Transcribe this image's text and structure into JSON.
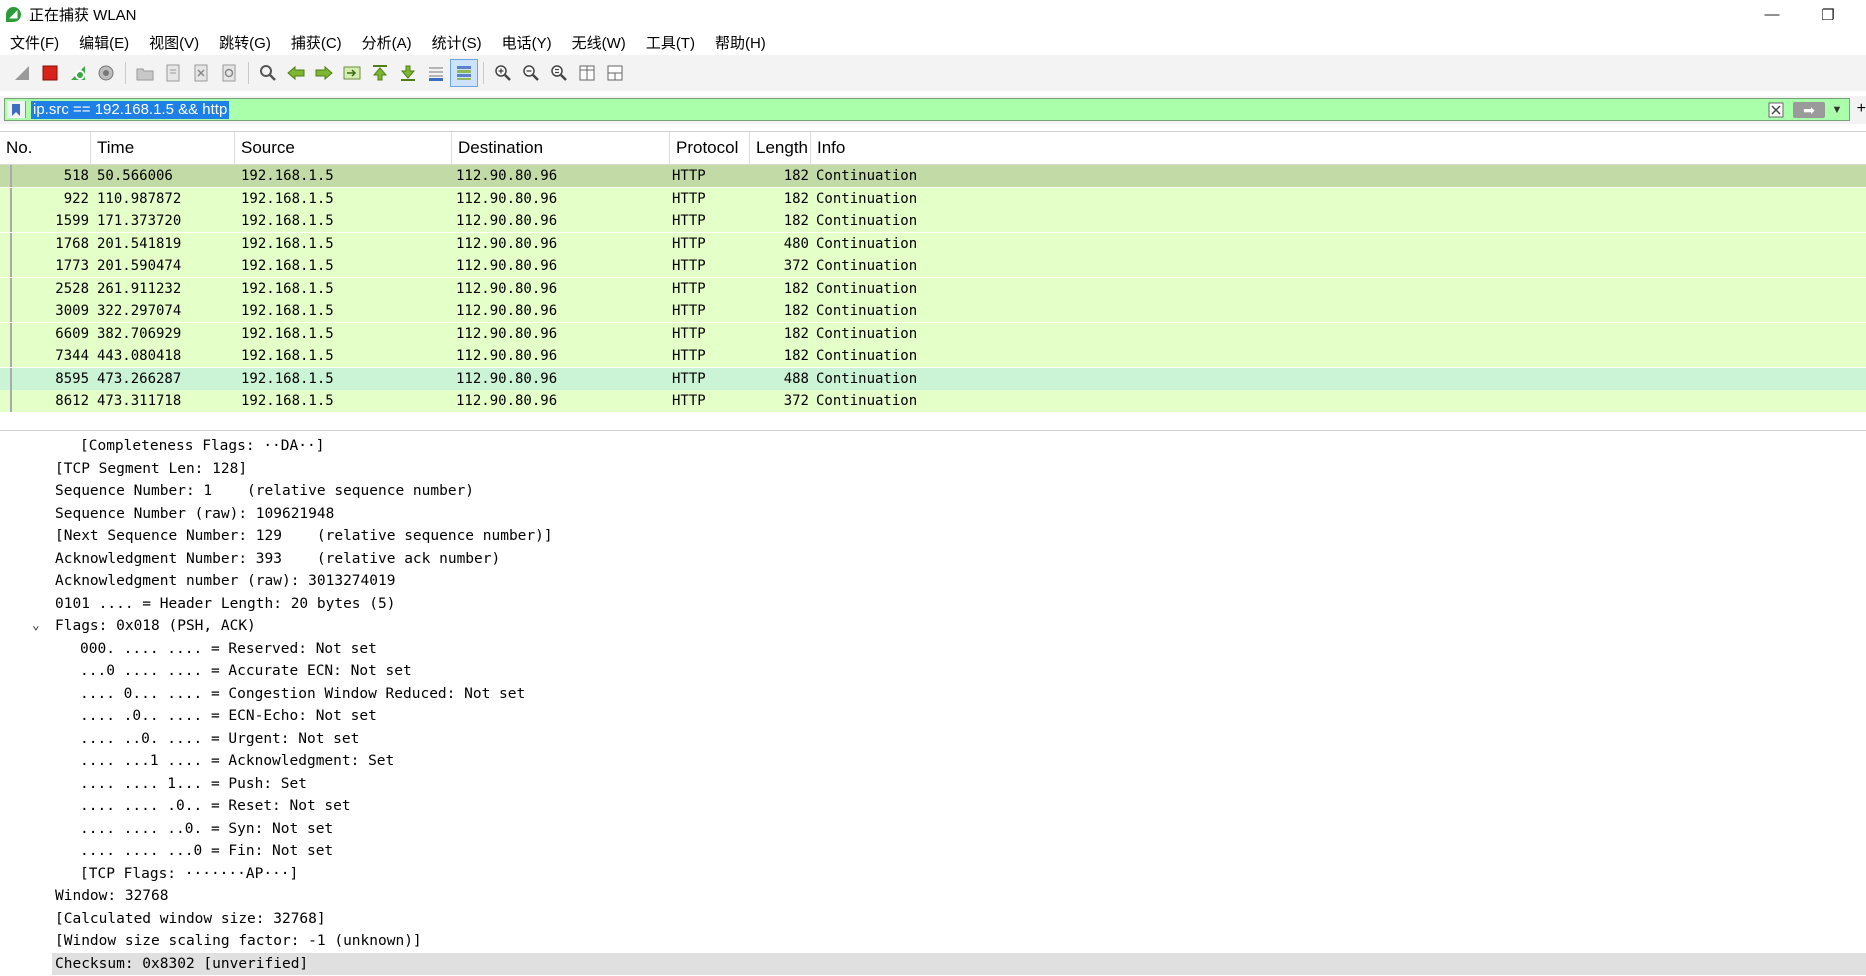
{
  "window": {
    "title": "正在捕获 WLAN",
    "minimize_glyph": "—",
    "restore_glyph": "❐"
  },
  "menu": [
    "文件(F)",
    "编辑(E)",
    "视图(V)",
    "跳转(G)",
    "捕获(C)",
    "分析(A)",
    "统计(S)",
    "电话(Y)",
    "无线(W)",
    "工具(T)",
    "帮助(H)"
  ],
  "toolbar": {
    "icons": [
      "shark-fin-icon",
      "stop-capture-icon",
      "restart-capture-icon",
      "capture-options-icon",
      "open-file-icon",
      "save-file-icon",
      "close-file-icon",
      "reload-file-icon",
      "find-packet-icon",
      "go-back-icon",
      "go-forward-icon",
      "go-to-packet-icon",
      "go-first-icon",
      "go-last-icon",
      "autoscroll-icon",
      "colorize-icon",
      "zoom-in-icon",
      "zoom-out-icon",
      "zoom-normal-icon",
      "resize-columns-icon",
      "layout-icon"
    ]
  },
  "filter": {
    "value": "ip.src == 192.168.1.5 && http",
    "plus": "+"
  },
  "columns": [
    "No.",
    "Time",
    "Source",
    "Destination",
    "Protocol",
    "Length",
    "Info"
  ],
  "packets": [
    {
      "no": "518",
      "time": "50.566006",
      "src": "192.168.1.5",
      "dst": "112.90.80.96",
      "proto": "HTTP",
      "len": "182",
      "info": "Continuation",
      "state": "selected"
    },
    {
      "no": "922",
      "time": "110.987872",
      "src": "192.168.1.5",
      "dst": "112.90.80.96",
      "proto": "HTTP",
      "len": "182",
      "info": "Continuation",
      "state": "normal"
    },
    {
      "no": "1599",
      "time": "171.373720",
      "src": "192.168.1.5",
      "dst": "112.90.80.96",
      "proto": "HTTP",
      "len": "182",
      "info": "Continuation",
      "state": "normal"
    },
    {
      "no": "1768",
      "time": "201.541819",
      "src": "192.168.1.5",
      "dst": "112.90.80.96",
      "proto": "HTTP",
      "len": "480",
      "info": "Continuation",
      "state": "normal"
    },
    {
      "no": "1773",
      "time": "201.590474",
      "src": "192.168.1.5",
      "dst": "112.90.80.96",
      "proto": "HTTP",
      "len": "372",
      "info": "Continuation",
      "state": "normal"
    },
    {
      "no": "2528",
      "time": "261.911232",
      "src": "192.168.1.5",
      "dst": "112.90.80.96",
      "proto": "HTTP",
      "len": "182",
      "info": "Continuation",
      "state": "normal"
    },
    {
      "no": "3009",
      "time": "322.297074",
      "src": "192.168.1.5",
      "dst": "112.90.80.96",
      "proto": "HTTP",
      "len": "182",
      "info": "Continuation",
      "state": "normal"
    },
    {
      "no": "6609",
      "time": "382.706929",
      "src": "192.168.1.5",
      "dst": "112.90.80.96",
      "proto": "HTTP",
      "len": "182",
      "info": "Continuation",
      "state": "normal"
    },
    {
      "no": "7344",
      "time": "443.080418",
      "src": "192.168.1.5",
      "dst": "112.90.80.96",
      "proto": "HTTP",
      "len": "182",
      "info": "Continuation",
      "state": "normal"
    },
    {
      "no": "8595",
      "time": "473.266287",
      "src": "192.168.1.5",
      "dst": "112.90.80.96",
      "proto": "HTTP",
      "len": "488",
      "info": "Continuation",
      "state": "alt"
    },
    {
      "no": "8612",
      "time": "473.311718",
      "src": "192.168.1.5",
      "dst": "112.90.80.96",
      "proto": "HTTP",
      "len": "372",
      "info": "Continuation",
      "state": "normal"
    }
  ],
  "details": [
    {
      "text": "[Completeness Flags: ··DA··]",
      "indent": 2
    },
    {
      "text": "[TCP Segment Len: 128]",
      "indent": 1
    },
    {
      "text": "Sequence Number: 1    (relative sequence number)",
      "indent": 1
    },
    {
      "text": "Sequence Number (raw): 109621948",
      "indent": 1
    },
    {
      "text": "[Next Sequence Number: 129    (relative sequence number)]",
      "indent": 1
    },
    {
      "text": "Acknowledgment Number: 393    (relative ack number)",
      "indent": 1
    },
    {
      "text": "Acknowledgment number (raw): 3013274019",
      "indent": 1
    },
    {
      "text": "0101 .... = Header Length: 20 bytes (5)",
      "indent": 1
    },
    {
      "text": "Flags: 0x018 (PSH, ACK)",
      "indent": 1,
      "expanded": true
    },
    {
      "text": "000. .... .... = Reserved: Not set",
      "indent": 2
    },
    {
      "text": "...0 .... .... = Accurate ECN: Not set",
      "indent": 2
    },
    {
      "text": ".... 0... .... = Congestion Window Reduced: Not set",
      "indent": 2
    },
    {
      "text": ".... .0.. .... = ECN-Echo: Not set",
      "indent": 2
    },
    {
      "text": ".... ..0. .... = Urgent: Not set",
      "indent": 2
    },
    {
      "text": ".... ...1 .... = Acknowledgment: Set",
      "indent": 2
    },
    {
      "text": ".... .... 1... = Push: Set",
      "indent": 2
    },
    {
      "text": ".... .... .0.. = Reset: Not set",
      "indent": 2
    },
    {
      "text": ".... .... ..0. = Syn: Not set",
      "indent": 2
    },
    {
      "text": ".... .... ...0 = Fin: Not set",
      "indent": 2
    },
    {
      "text": "[TCP Flags: ·······AP···]",
      "indent": 2
    },
    {
      "text": "Window: 32768",
      "indent": 1
    },
    {
      "text": "[Calculated window size: 32768]",
      "indent": 1
    },
    {
      "text": "[Window size scaling factor: -1 (unknown)]",
      "indent": 1
    },
    {
      "text": "Checksum: 0x8302 [unverified]",
      "indent": 1,
      "highlight": true
    }
  ]
}
